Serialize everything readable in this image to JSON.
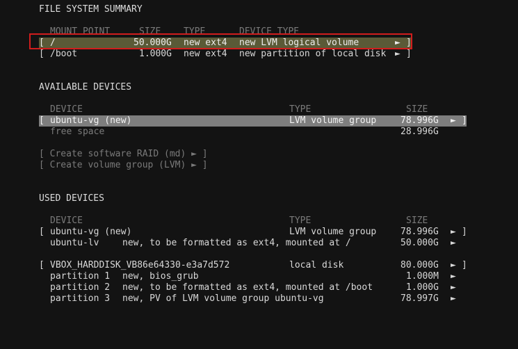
{
  "fs_summary": {
    "title": "FILE SYSTEM SUMMARY",
    "headers": {
      "mount": "MOUNT POINT",
      "size": "SIZE",
      "type": "TYPE",
      "device_type": "DEVICE TYPE"
    },
    "rows": [
      {
        "bracket_open": "[",
        "mount": "/",
        "size": "50.000G",
        "type": "new ext4",
        "device_type": "new LVM logical volume",
        "arrow": "►",
        "bracket_close": "]"
      },
      {
        "bracket_open": "[",
        "mount": "/boot",
        "size": "1.000G",
        "type": "new ext4",
        "device_type": "new partition of local disk",
        "arrow": "►",
        "bracket_close": "]"
      }
    ]
  },
  "available": {
    "title": "AVAILABLE DEVICES",
    "headers": {
      "device": "DEVICE",
      "type": "TYPE",
      "size": "SIZE"
    },
    "rows": [
      {
        "bracket_open": "[",
        "device": "ubuntu-vg (new)",
        "type": "LVM volume group",
        "size": "78.996G",
        "arrow": "►",
        "bracket_close": "]"
      },
      {
        "device": "free space",
        "size": "28.996G"
      }
    ],
    "actions": [
      "[ Create software RAID (md) ► ]",
      "[ Create volume group (LVM) ► ]"
    ]
  },
  "used": {
    "title": "USED DEVICES",
    "headers": {
      "device": "DEVICE",
      "type": "TYPE",
      "size": "SIZE"
    },
    "rows": [
      {
        "bracket_open": "[",
        "device": "ubuntu-vg (new)",
        "type": "LVM volume group",
        "size": "78.996G",
        "arrow": "►",
        "bracket_close": "]"
      },
      {
        "device": "ubuntu-lv",
        "desc": "new, to be formatted as ext4, mounted at /",
        "size": "50.000G",
        "arrow": "►"
      },
      {
        "bracket_open": "[",
        "device": "VBOX_HARDDISK_VB86e64330-e3a7d572",
        "type": "local disk",
        "size": "80.000G",
        "arrow": "►",
        "bracket_close": "]"
      },
      {
        "device": "partition 1",
        "desc": "new, bios_grub",
        "size": "1.000M",
        "arrow": "►"
      },
      {
        "device": "partition 2",
        "desc": "new, to be formatted as ext4, mounted at /boot",
        "size": "1.000G",
        "arrow": "►"
      },
      {
        "device": "partition 3",
        "desc": "new, PV of LVM volume group ubuntu-vg",
        "size": "78.997G",
        "arrow": "►"
      }
    ]
  },
  "colors": {
    "background": "#131313",
    "highlight": "#7e7e7e",
    "highlight_focus": "#5a5a37",
    "annotation_box": "#d11d1d",
    "dim_text": "#7a7a7a"
  }
}
